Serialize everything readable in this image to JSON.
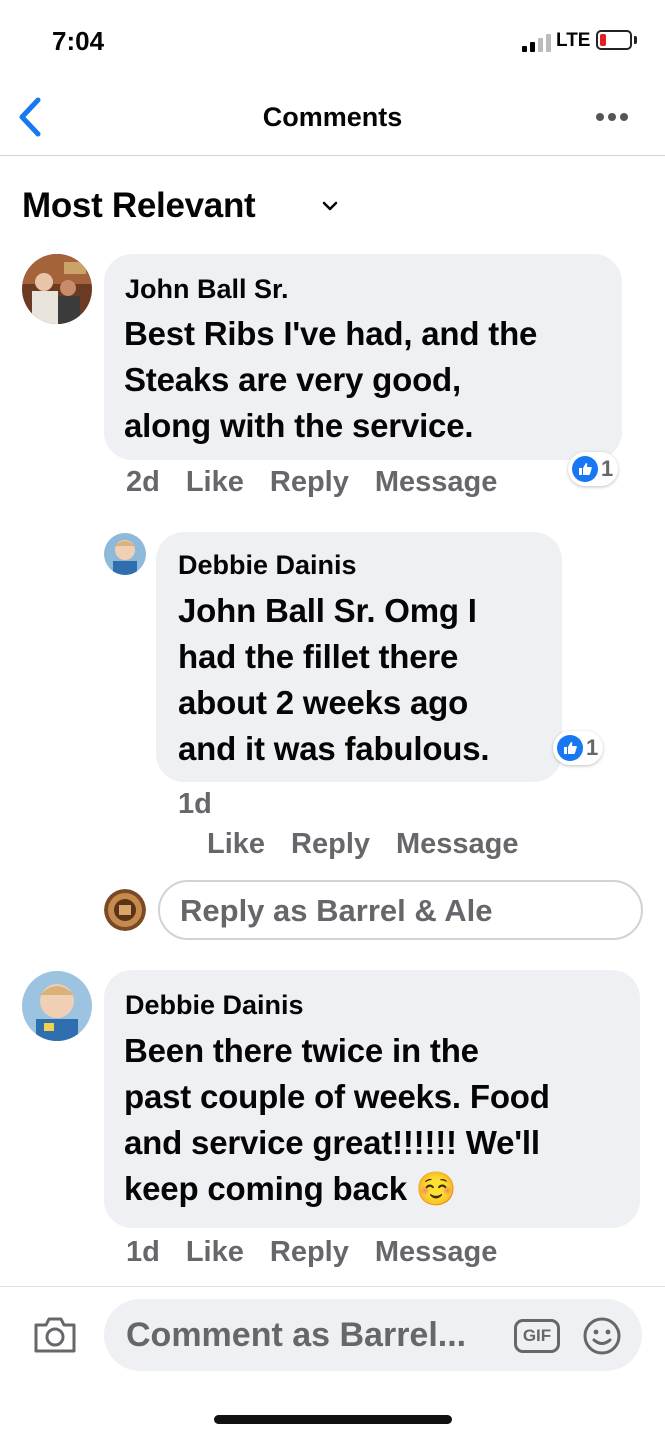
{
  "status_bar": {
    "time": "7:04",
    "network": "LTE"
  },
  "nav": {
    "title": "Comments"
  },
  "sort": {
    "label": "Most Relevant"
  },
  "comments": [
    {
      "author": "John Ball Sr.",
      "lines": [
        "Best Ribs I've had, and the",
        "Steaks are very good,",
        "along with the service."
      ],
      "age": "2d",
      "reaction_count": "1",
      "actions": {
        "like": "Like",
        "reply": "Reply",
        "message": "Message"
      }
    },
    {
      "author": "Debbie Dainis",
      "mention": "John Ball Sr.",
      "lines": [
        " Omg I",
        "had the fillet there",
        "about 2 weeks ago",
        "and it was fabulous."
      ],
      "age": "1d",
      "reaction_count": "1",
      "actions": {
        "like": "Like",
        "reply": "Reply",
        "message": "Message"
      }
    },
    {
      "author": "Debbie Dainis",
      "lines": [
        "Been there twice in the",
        "past couple of weeks. Food",
        "and service great!!!!!! We'll",
        "keep coming back"
      ],
      "emoji": "☺️",
      "age": "1d",
      "actions": {
        "like": "Like",
        "reply": "Reply",
        "message": "Message"
      }
    }
  ],
  "reply_box": {
    "placeholder": "Reply as Barrel & Ale"
  },
  "composer": {
    "placeholder": "Comment as Barrel...",
    "gif_label": "GIF"
  },
  "colors": {
    "accent": "#1877f2",
    "bubble": "#eef0f3",
    "secondary_text": "#65676b",
    "battery_low": "#e02020"
  }
}
